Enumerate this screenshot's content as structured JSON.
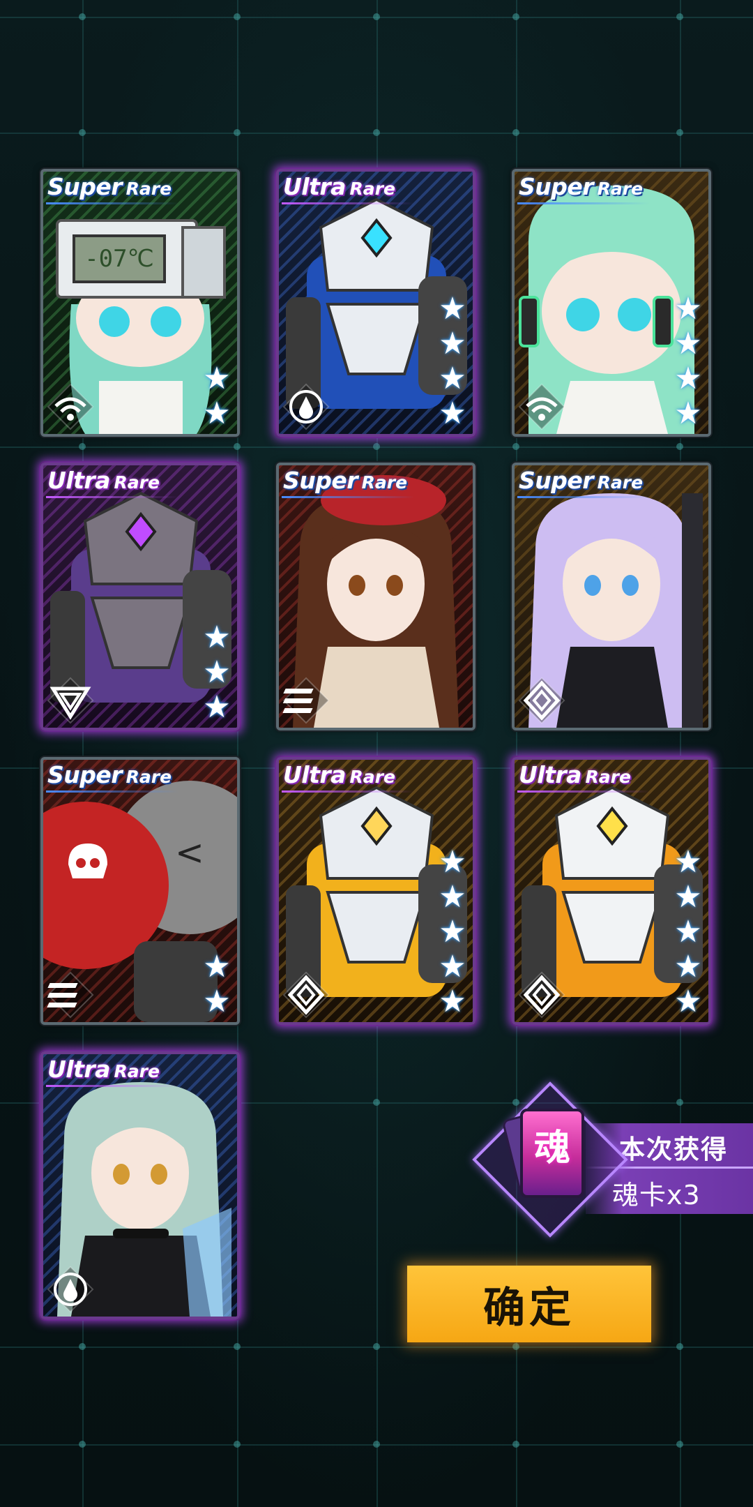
{
  "cards": [
    {
      "rarity_big": "Super",
      "rarity_small": "Rare",
      "rarity": "sr",
      "theme": "green",
      "stars": 2,
      "class_icon": "wifi-class-icon",
      "subject": "chibi-robot-head-girl",
      "display_text": "-07℃"
    },
    {
      "rarity_big": "Ultra",
      "rarity_small": "Rare",
      "rarity": "ur",
      "theme": "blue",
      "stars": 4,
      "class_icon": "drop-circle-class-icon",
      "subject": "blue-mech"
    },
    {
      "rarity_big": "Super",
      "rarity_small": "Rare",
      "rarity": "sr",
      "theme": "gold",
      "stars": 4,
      "class_icon": "wifi-class-icon",
      "subject": "chibi-headphone-girl"
    },
    {
      "rarity_big": "Ultra",
      "rarity_small": "Rare",
      "rarity": "ur",
      "theme": "purple",
      "stars": 3,
      "class_icon": "triangle-class-icon",
      "subject": "purple-mech"
    },
    {
      "rarity_big": "Super",
      "rarity_small": "Rare",
      "rarity": "sr",
      "theme": "red",
      "stars": 0,
      "class_icon": "chevron-stripes-class-icon",
      "subject": "beret-girl"
    },
    {
      "rarity_big": "Super",
      "rarity_small": "Rare",
      "rarity": "sr",
      "theme": "gold",
      "stars": 0,
      "class_icon": "diamond-class-icon",
      "subject": "lavender-hair-girl"
    },
    {
      "rarity_big": "Super",
      "rarity_small": "Rare",
      "rarity": "sr",
      "theme": "red",
      "stars": 2,
      "class_icon": "chevron-stripes-class-icon",
      "subject": "skull-bomb-chibi"
    },
    {
      "rarity_big": "Ultra",
      "rarity_small": "Rare",
      "rarity": "ur",
      "theme": "gold",
      "stars": 5,
      "class_icon": "diamond-class-icon",
      "subject": "yellow-mech"
    },
    {
      "rarity_big": "Ultra",
      "rarity_small": "Rare",
      "rarity": "ur",
      "theme": "gold",
      "stars": 5,
      "class_icon": "diamond-class-icon",
      "subject": "white-orange-mech"
    },
    {
      "rarity_big": "Ultra",
      "rarity_small": "Rare",
      "rarity": "ur",
      "theme": "blue",
      "stars": 0,
      "class_icon": "drop-circle-class-icon",
      "subject": "silver-hair-girl"
    }
  ],
  "reward": {
    "title": "本次获得",
    "amount": "魂卡x3",
    "card_char": "魂"
  },
  "confirm": {
    "label": "确定"
  },
  "colors": {
    "sr_border": "#5b6a72",
    "ur_glow": "#be46ff",
    "button": "#f6a714",
    "star_glow": "#4bb2ff",
    "grid": "#286e6e"
  }
}
